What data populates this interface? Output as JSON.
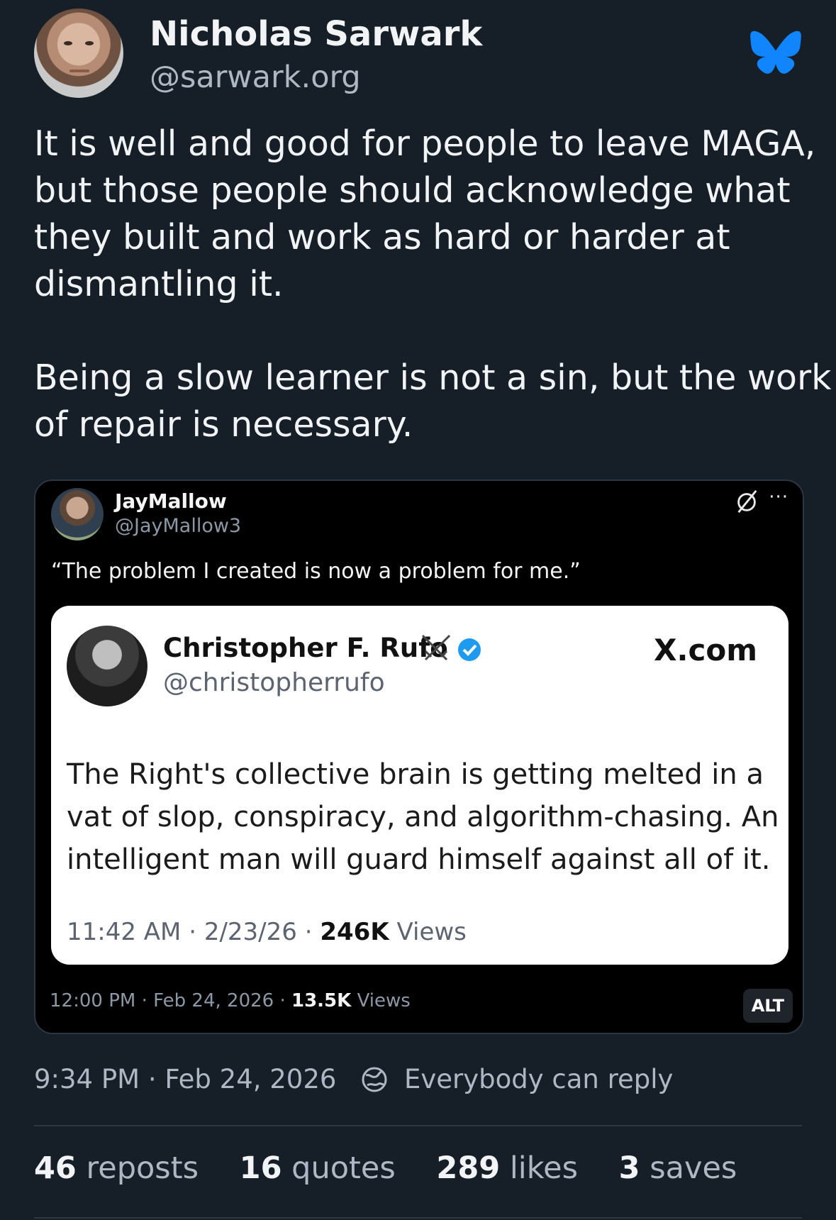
{
  "author": {
    "display_name": "Nicholas Sarwark",
    "handle": "@sarwark.org"
  },
  "post": {
    "paragraph1_lines": [
      "It is well and good for people to leave MAGA,",
      "but those people should acknowledge what",
      "they built and work as hard or harder at",
      "dismantling it."
    ],
    "paragraph2_lines": [
      "Being a slow learner is not a sin, but the work",
      "of repair is necessary."
    ],
    "time": "9:34 PM",
    "separator": "·",
    "date": "Feb 24, 2026",
    "reply_setting": "Everybody can reply"
  },
  "embed": {
    "name": "JayMallow",
    "handle": "@JayMallow3",
    "quote": "“The problem I created is now a problem for me.”",
    "time": "12:00 PM",
    "date": "Feb 24, 2026",
    "views_count": "13.5K",
    "views_label": "Views",
    "alt_label": "ALT"
  },
  "card": {
    "name": "Christopher F. Rufo",
    "handle": "@christopherrufo",
    "source": "X.com",
    "text_lines": [
      "The Right's collective brain is getting melted in a",
      "vat of slop, conspiracy, and algorithm-chasing. An",
      "intelligent man will guard himself against all of it."
    ],
    "time": "11:42 AM",
    "date": "2/23/26",
    "views_count": "246K",
    "views_label": "Views"
  },
  "stats": [
    {
      "count": "46",
      "label": "reposts"
    },
    {
      "count": "16",
      "label": "quotes"
    },
    {
      "count": "289",
      "label": "likes"
    },
    {
      "count": "3",
      "label": "saves"
    }
  ],
  "colors": {
    "background": "#161e27",
    "bluesky_blue": "#1185fe",
    "verified_blue": "#1d9bf0"
  }
}
